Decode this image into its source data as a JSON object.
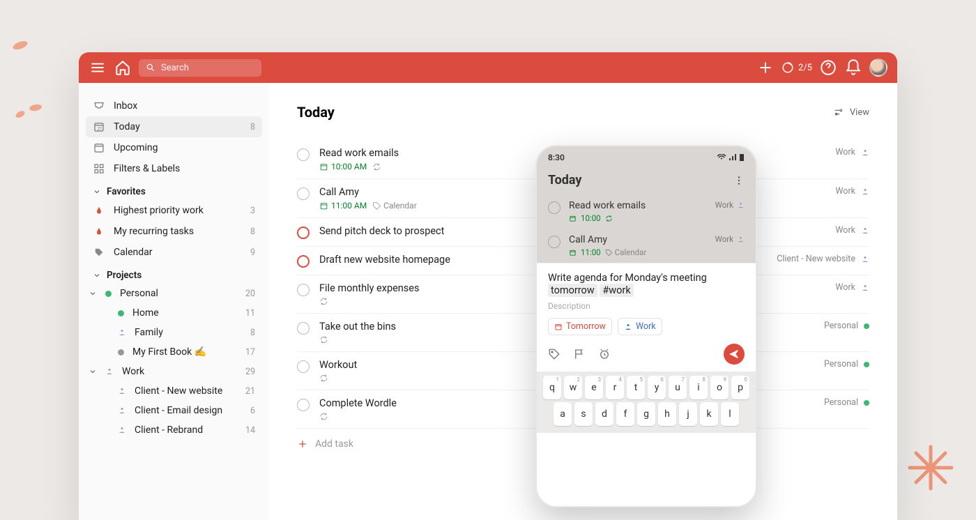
{
  "header": {
    "search_placeholder": "Search",
    "progress": "2/5"
  },
  "sidebar": {
    "inbox": "Inbox",
    "today": "Today",
    "today_count": "8",
    "upcoming": "Upcoming",
    "filters": "Filters & Labels",
    "favorites_header": "Favorites",
    "favorites": [
      {
        "label": "Highest priority work",
        "count": "3"
      },
      {
        "label": "My recurring tasks",
        "count": "8"
      },
      {
        "label": "Calendar",
        "count": "9"
      }
    ],
    "projects_header": "Projects",
    "projects": [
      {
        "label": "Personal",
        "count": "20",
        "color": "#3bba6f",
        "children": [
          {
            "label": "Home",
            "count": "11",
            "icon": "dot",
            "color": "#3bba6f"
          },
          {
            "label": "Family",
            "count": "8",
            "icon": "person",
            "color": "#a970ff"
          },
          {
            "label": "My First Book ✍️",
            "count": "17",
            "icon": "dot",
            "color": "#999"
          }
        ]
      },
      {
        "label": "Work",
        "count": "29",
        "color": "#a970ff",
        "icon": "person",
        "children": [
          {
            "label": "Client - New website",
            "count": "21",
            "icon": "person"
          },
          {
            "label": "Client - Email design",
            "count": "6",
            "icon": "person"
          },
          {
            "label": "Client - Rebrand",
            "count": "14",
            "icon": "person"
          }
        ]
      }
    ]
  },
  "main": {
    "title": "Today",
    "view_label": "View",
    "add_task_label": "Add task",
    "tasks": [
      {
        "title": "Read work emails",
        "time": "10:00 AM",
        "recurring": true,
        "project": "Work",
        "pcolor": "#a970ff",
        "picon": "person"
      },
      {
        "title": "Call Amy",
        "time": "11:00 AM",
        "label": "Calendar",
        "project": "Work",
        "pcolor": "#a970ff",
        "picon": "person"
      },
      {
        "title": "Send pitch deck to prospect",
        "priority": "red",
        "project": "Work",
        "pcolor": "#a970ff",
        "picon": "person"
      },
      {
        "title": "Draft new website homepage",
        "priority": "red",
        "project": "Client - New website",
        "pcolor": "#a970ff",
        "picon": "person"
      },
      {
        "title": "File monthly expenses",
        "recurring": true,
        "project": "Work",
        "pcolor": "#a970ff",
        "picon": "person"
      },
      {
        "title": "Take out the bins",
        "recurring": true,
        "project": "Personal",
        "pcolor": "#3bba6f",
        "picon": "dot"
      },
      {
        "title": "Workout",
        "recurring": true,
        "project": "Personal",
        "pcolor": "#3bba6f",
        "picon": "dot"
      },
      {
        "title": "Complete Wordle",
        "recurring": true,
        "project": "Personal",
        "pcolor": "#3bba6f",
        "picon": "dot"
      }
    ]
  },
  "phone": {
    "time": "8:30",
    "title": "Today",
    "tasks": [
      {
        "title": "Read work emails",
        "time": "10:00",
        "recurring": true,
        "project": "Work"
      },
      {
        "title": "Call Amy",
        "time": "11:00",
        "label": "Calendar",
        "project": "Work"
      }
    ],
    "compose": {
      "title": "Write agenda for Monday's meeting",
      "chip_date": "tomorrow",
      "chip_tag": "#work",
      "description": "Description",
      "pill_date": "Tomorrow",
      "pill_project": "Work"
    },
    "keyboard": {
      "row1": [
        "q",
        "w",
        "e",
        "r",
        "t",
        "y",
        "u",
        "i",
        "o",
        "p"
      ],
      "row1_nums": [
        "1",
        "2",
        "3",
        "4",
        "5",
        "6",
        "7",
        "8",
        "9",
        "0"
      ],
      "row2": [
        "a",
        "s",
        "d",
        "f",
        "g",
        "h",
        "j",
        "k",
        "l"
      ]
    }
  }
}
